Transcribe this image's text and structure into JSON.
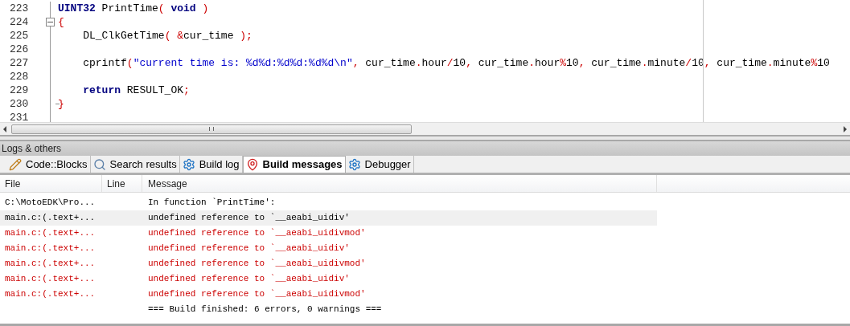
{
  "editor": {
    "lines": [
      {
        "number": "223",
        "fold_start": false,
        "fold_end": false,
        "tokens": [
          {
            "kind": "kw",
            "text": "UINT32"
          },
          {
            "kind": "text",
            "text": " PrintTime"
          },
          {
            "kind": "op",
            "text": "( "
          },
          {
            "kind": "kw",
            "text": "void"
          },
          {
            "kind": "op",
            "text": " )"
          }
        ]
      },
      {
        "number": "224",
        "fold_start": true,
        "fold_end": false,
        "tokens": [
          {
            "kind": "op",
            "text": "{"
          }
        ]
      },
      {
        "number": "225",
        "fold_start": false,
        "fold_end": false,
        "tokens": [
          {
            "kind": "text",
            "text": "    DL_ClkGetTime"
          },
          {
            "kind": "op",
            "text": "( &"
          },
          {
            "kind": "text",
            "text": "cur_time"
          },
          {
            "kind": "op",
            "text": " );"
          }
        ]
      },
      {
        "number": "226",
        "fold_start": false,
        "fold_end": false
      },
      {
        "number": "227",
        "fold_start": false,
        "fold_end": false,
        "tokens": [
          {
            "kind": "text",
            "text": "    cprintf"
          },
          {
            "kind": "op",
            "text": "("
          },
          {
            "kind": "str",
            "text": "\"current time is: %d%d:%d%d:%d%d\\n\""
          },
          {
            "kind": "op",
            "text": ", "
          },
          {
            "kind": "text",
            "text": "cur_time"
          },
          {
            "kind": "op",
            "text": "."
          },
          {
            "kind": "text",
            "text": "hour"
          },
          {
            "kind": "op",
            "text": "/"
          },
          {
            "kind": "text",
            "text": "10"
          },
          {
            "kind": "op",
            "text": ", "
          },
          {
            "kind": "text",
            "text": "cur_time"
          },
          {
            "kind": "op",
            "text": "."
          },
          {
            "kind": "text",
            "text": "hour"
          },
          {
            "kind": "op",
            "text": "%"
          },
          {
            "kind": "text",
            "text": "10"
          },
          {
            "kind": "op",
            "text": ", "
          },
          {
            "kind": "text",
            "text": "cur_time"
          },
          {
            "kind": "op",
            "text": "."
          },
          {
            "kind": "text",
            "text": "minute"
          },
          {
            "kind": "op",
            "text": "/"
          },
          {
            "kind": "text",
            "text": "10"
          },
          {
            "kind": "op",
            "text": ", "
          },
          {
            "kind": "text",
            "text": "cur_time"
          },
          {
            "kind": "op",
            "text": "."
          },
          {
            "kind": "text",
            "text": "minute"
          },
          {
            "kind": "op",
            "text": "%"
          },
          {
            "kind": "text",
            "text": "10"
          }
        ]
      },
      {
        "number": "228",
        "fold_start": false,
        "fold_end": false
      },
      {
        "number": "229",
        "fold_start": false,
        "fold_end": false,
        "tokens": [
          {
            "kind": "kw",
            "text": "    return"
          },
          {
            "kind": "text",
            "text": " RESULT_OK"
          },
          {
            "kind": "op",
            "text": ";"
          }
        ]
      },
      {
        "number": "230",
        "fold_start": false,
        "fold_end": true,
        "tokens": [
          {
            "kind": "op",
            "text": "}"
          }
        ]
      },
      {
        "number": "231",
        "fold_start": false,
        "fold_end": false
      }
    ]
  },
  "panel": {
    "title": "Logs & others",
    "tabs": [
      {
        "label": "Code::Blocks",
        "selected": false
      },
      {
        "label": "Search results",
        "selected": false
      },
      {
        "label": "Build log",
        "selected": false
      },
      {
        "label": "Build messages",
        "selected": true
      },
      {
        "label": "Debugger",
        "selected": false
      }
    ],
    "columns": [
      "File",
      "Line",
      "Message"
    ],
    "rows": [
      {
        "file": "C:\\MotoEDK\\Pro...",
        "message": "In function `PrintTime':",
        "color": "#000000",
        "selected": false
      },
      {
        "file": "main.c:(.text+...",
        "message": "undefined reference to `__aeabi_uidiv'",
        "color": "#000000",
        "selected": true
      },
      {
        "file": "main.c:(.text+...",
        "message": "undefined reference to `__aeabi_uidivmod'",
        "color": "#cc0000",
        "selected": false
      },
      {
        "file": "main.c:(.text+...",
        "message": "undefined reference to `__aeabi_uidiv'",
        "color": "#cc0000",
        "selected": false
      },
      {
        "file": "main.c:(.text+...",
        "message": "undefined reference to `__aeabi_uidivmod'",
        "color": "#cc0000",
        "selected": false
      },
      {
        "file": "main.c:(.text+...",
        "message": "undefined reference to `__aeabi_uidiv'",
        "color": "#cc0000",
        "selected": false
      },
      {
        "file": "main.c:(.text+...",
        "message": "undefined reference to `__aeabi_uidivmod'",
        "color": "#cc0000",
        "selected": false
      },
      {
        "message": "=== Build finished: 6 errors, 0 warnings ===",
        "color": "#000000",
        "selected": false
      }
    ]
  }
}
